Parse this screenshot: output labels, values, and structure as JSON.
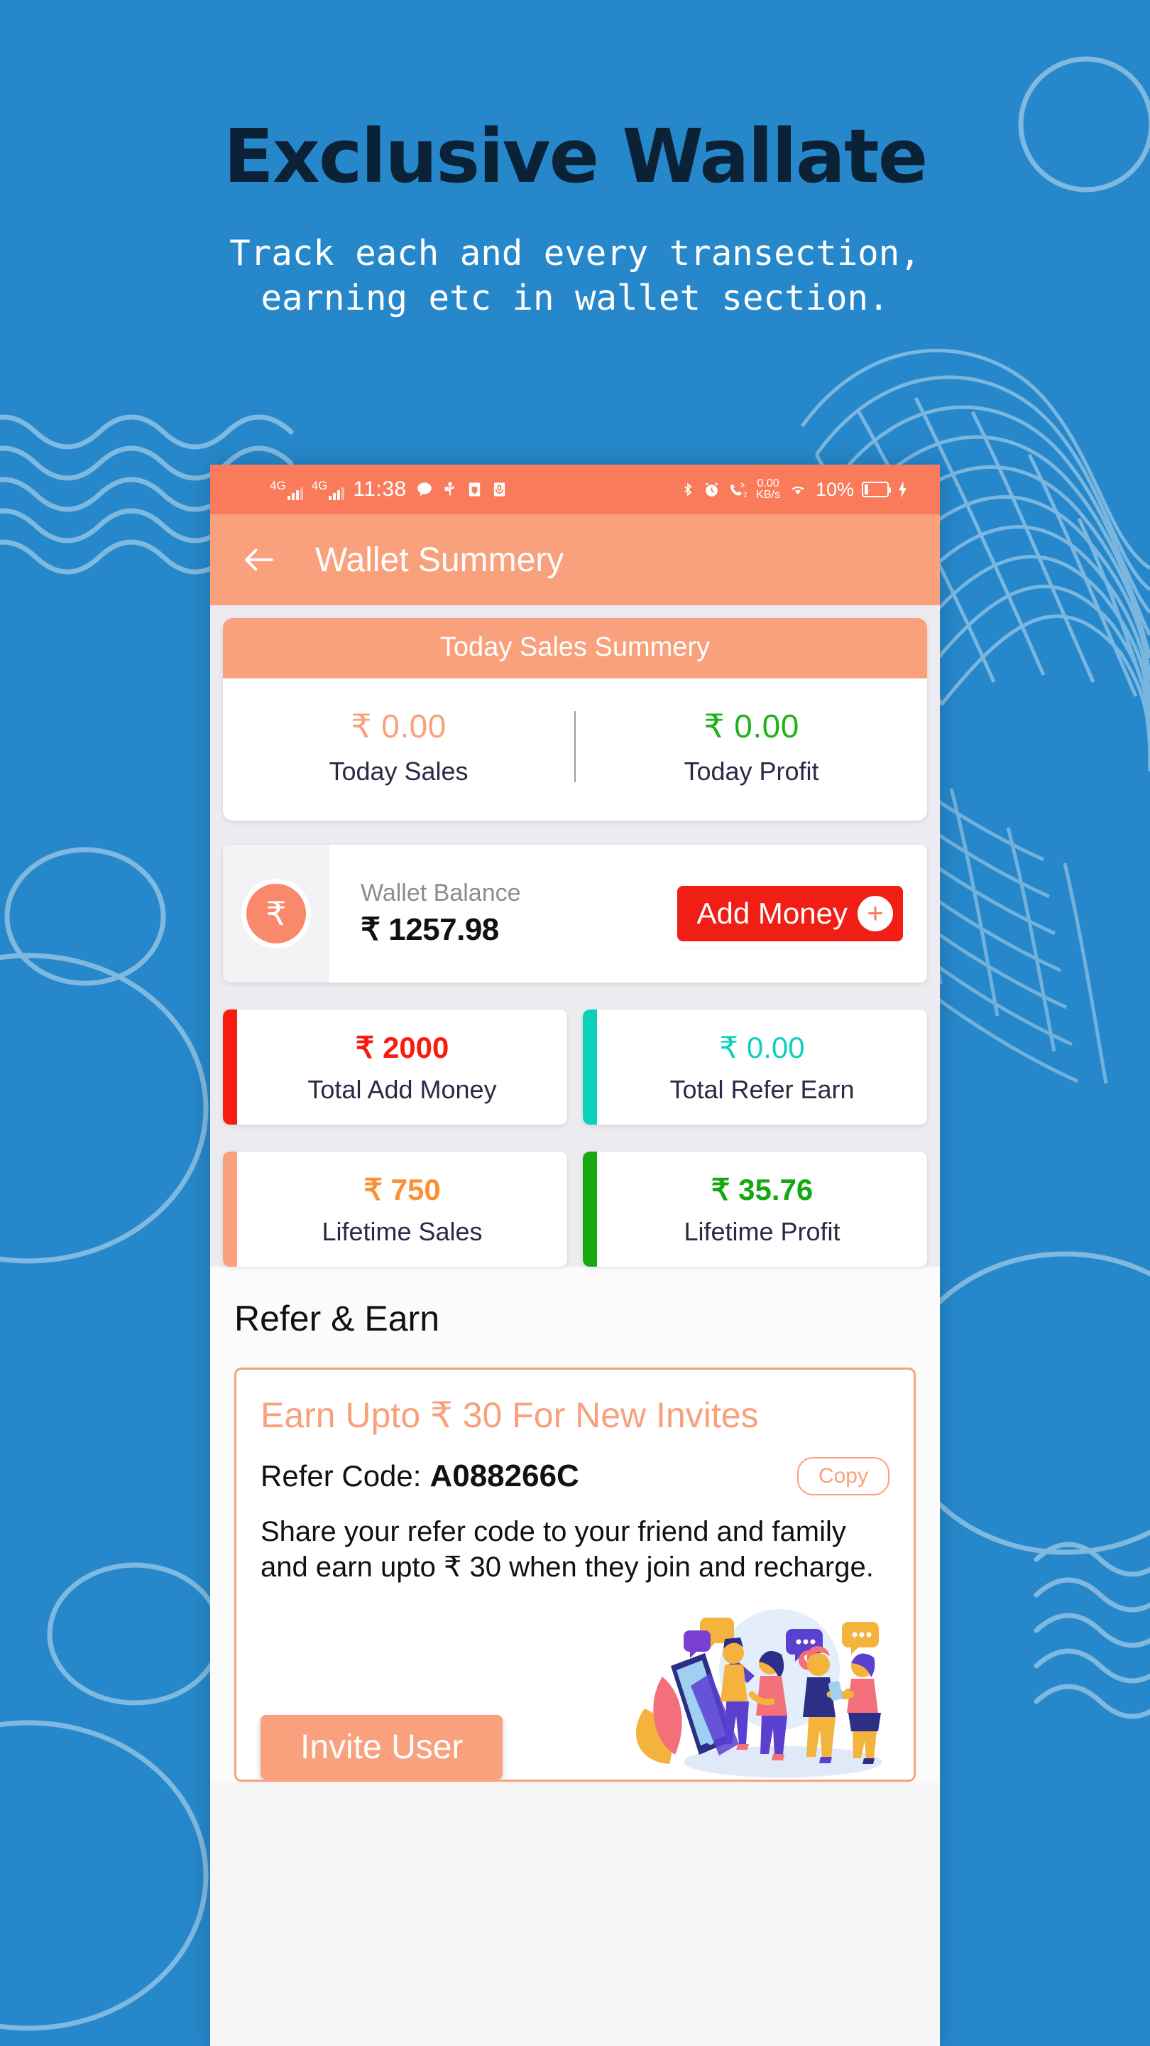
{
  "promo": {
    "title": "Exclusive Wallate",
    "subtitle_line1": "Track each and every transection,",
    "subtitle_line2": "earning etc in wallet section.",
    "bg_color": "#2688cb",
    "title_color": "#0b2236"
  },
  "statusbar": {
    "network_left_1": "4G",
    "network_left_2": "4G",
    "time": "11:38",
    "icons_left": [
      "message-icon",
      "usb-icon",
      "sim-icon",
      "mic-icon"
    ],
    "bluetooth": "bluetooth-icon",
    "alarm": "alarm-icon",
    "call_sim": "call-sim2-icon",
    "data_rate": "0.00",
    "data_unit": "KB/s",
    "wifi": "wifi-icon",
    "battery_percent": "10%",
    "charging": "charging-bolt-icon",
    "bg_color": "#f97b5c"
  },
  "appbar": {
    "title": "Wallet Summery",
    "back_icon": "back-arrow-icon",
    "bg_color": "#f9a07c"
  },
  "today_card": {
    "header": "Today Sales Summery",
    "columns": [
      {
        "amount": "₹ 0.00",
        "label": "Today Sales",
        "color": "#f9a07c"
      },
      {
        "amount": "₹ 0.00",
        "label": "Today Profit",
        "color": "#21b21a"
      }
    ]
  },
  "wallet": {
    "icon": "rupee-icon",
    "icon_glyph": "₹",
    "balance_label": "Wallet Balance",
    "balance_amount": "₹ 1257.98",
    "add_money_label": "Add Money",
    "add_money_color": "#f01e14",
    "plus_icon": "plus-icon"
  },
  "stats": [
    {
      "amount": "₹ 2000",
      "label": "Total Add Money",
      "color": "#f81c10",
      "bar": "#f81c10"
    },
    {
      "amount": "₹ 0.00",
      "label": "Total Refer Earn",
      "color": "#0bd1bb",
      "bar": "#0bd1bb"
    },
    {
      "amount": "₹ 750",
      "label": "Lifetime Sales",
      "color": "#fa9132",
      "bar": "#f9a07c"
    },
    {
      "amount": "₹ 35.76",
      "label": "Lifetime Profit",
      "color": "#16a810",
      "bar": "#16a810"
    }
  ],
  "refer": {
    "section_title": "Refer & Earn",
    "headline": "Earn Upto ₹ 30 For New Invites",
    "code_label": "Refer Code:",
    "code_value": "A088266C",
    "copy_label": "Copy",
    "description": "Share your refer code to your friend and family and earn upto ₹ 30 when they join and recharge.",
    "invite_label": "Invite User",
    "illustration": "people-sharing-illustration",
    "accent_color": "#f9a07c"
  }
}
